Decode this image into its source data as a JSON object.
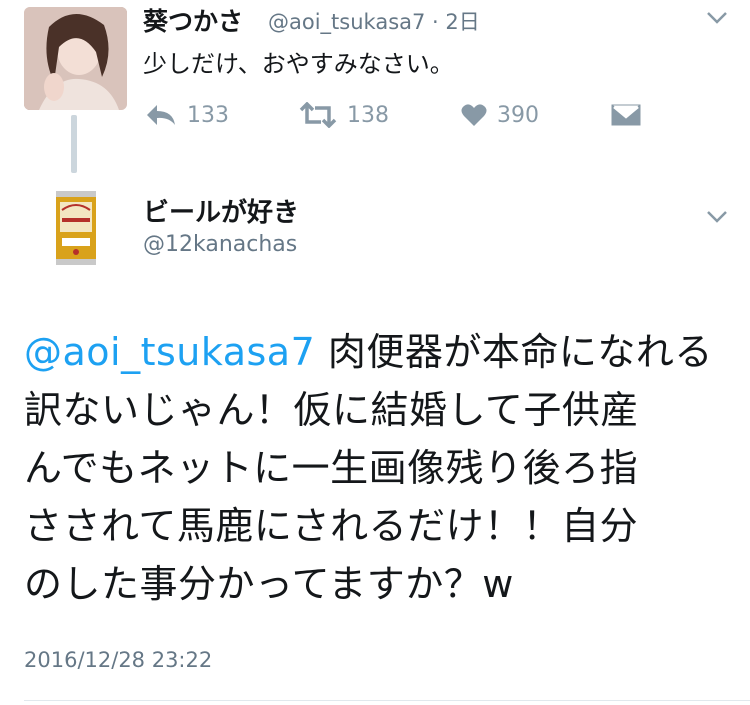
{
  "tweet1": {
    "display_name": "葵つかさ",
    "meta": "@aoi_tsukasa7 · 2日",
    "text": "少しだけ、おやすみなさい。",
    "actions": {
      "reply_count": "133",
      "retweet_count": "138",
      "like_count": "390"
    }
  },
  "tweet2": {
    "display_name": "ビールが好き",
    "handle": "@12kanachas",
    "mention": "@aoi_tsukasa7",
    "body_line1": " 肉便器が本命になれる",
    "body_line2": "訳ないじゃん！仮に結婚して子供産",
    "body_line3": "んでもネットに一生画像残り後ろ指",
    "body_line4": "さされて馬鹿にされるだけ！！自分",
    "body_line5": "のした事分かってますか？w",
    "timestamp": "2016/12/28 23:22"
  },
  "icons": {
    "menu": "chevron-down-icon",
    "reply": "reply-icon",
    "retweet": "retweet-icon",
    "like": "heart-icon",
    "dm": "envelope-icon"
  },
  "colors": {
    "link": "#1da1f2",
    "secondary": "#657786",
    "icon": "#8899a6",
    "text": "#14171a"
  }
}
